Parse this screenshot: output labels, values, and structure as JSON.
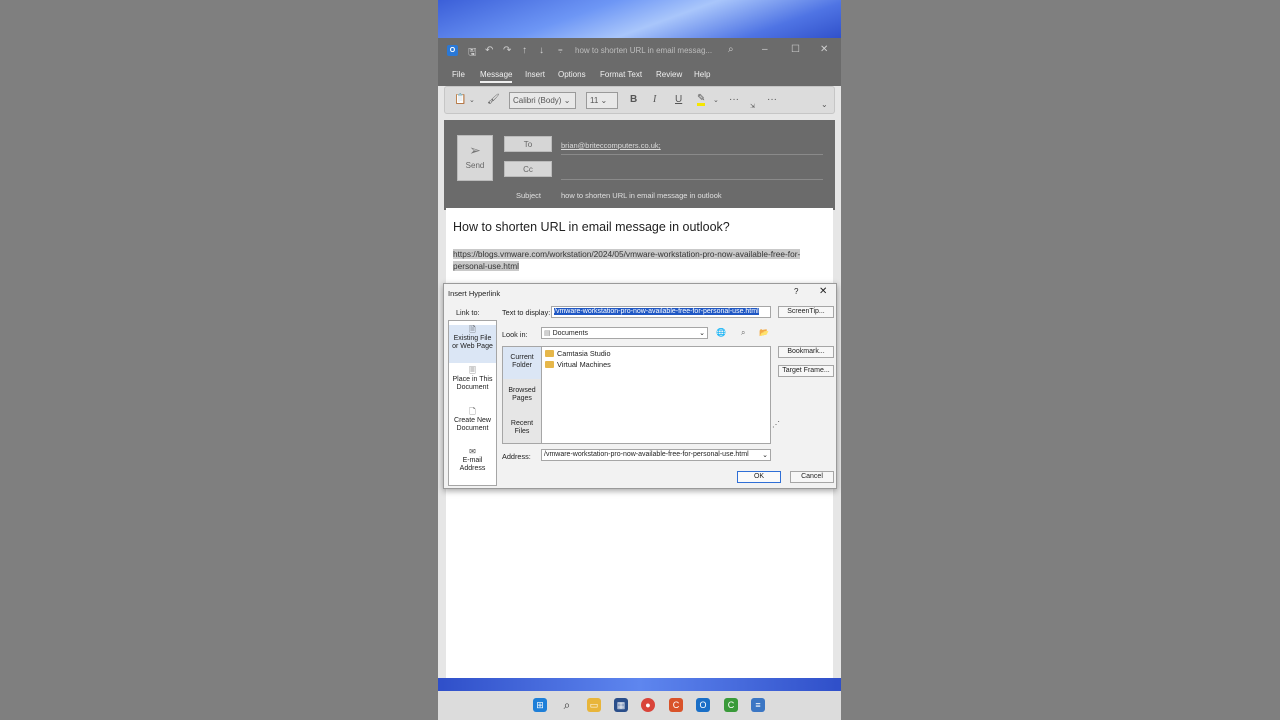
{
  "window": {
    "title": "how to shorten URL in email messag...",
    "menu": [
      "File",
      "Message",
      "Insert",
      "Options",
      "Format Text",
      "Review",
      "Help"
    ],
    "active_menu": "Message"
  },
  "ribbon": {
    "font_name": "Calibri (Body)",
    "font_size": "11",
    "bold": "B",
    "italic": "I",
    "underline": "U",
    "more": "···"
  },
  "compose": {
    "send_label": "Send",
    "to_label": "To",
    "cc_label": "Cc",
    "subject_label": "Subject",
    "to_value": "brian@briteccomputers.co.uk;",
    "subject_value": "how to shorten URL in email message in outlook"
  },
  "body": {
    "heading": "How to shorten URL in email message in outlook?",
    "link_text": "https://blogs.vmware.com/workstation/2024/05/vmware-workstation-pro-now-available-free-for-personal-use.html"
  },
  "dialog": {
    "title": "Insert Hyperlink",
    "help": "?",
    "close": "✕",
    "link_to_label": "Link to:",
    "text_to_display_label": "Text to display:",
    "text_to_display_value": "/vmware-workstation-pro-now-available-free-for-personal-use.html",
    "screentip_label": "ScreenTip...",
    "look_in_label": "Look in:",
    "look_in_value": "Documents",
    "link_options": [
      {
        "line1": "Existing File",
        "line2": "or Web Page"
      },
      {
        "line1": "Place in This",
        "line2": "Document"
      },
      {
        "line1": "Create New",
        "line2": "Document"
      },
      {
        "line1": "E-mail",
        "line2": "Address"
      }
    ],
    "tabs": [
      {
        "line1": "Current",
        "line2": "Folder"
      },
      {
        "line1": "Browsed",
        "line2": "Pages"
      },
      {
        "line1": "Recent",
        "line2": "Files"
      }
    ],
    "files": [
      "Camtasia Studio",
      "Virtual Machines"
    ],
    "bookmark_label": "Bookmark...",
    "target_frame_label": "Target Frame...",
    "address_label": "Address:",
    "address_value": "/vmware-workstation-pro-now-available-free-for-personal-use.html",
    "ok_label": "OK",
    "cancel_label": "Cancel"
  },
  "colors": {
    "accent": "#1f57c4",
    "outlook_blue": "#2a78d6"
  }
}
